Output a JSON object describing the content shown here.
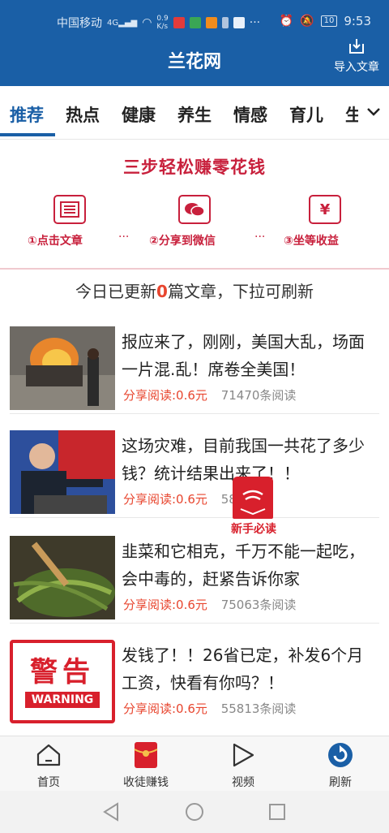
{
  "status_bar": {
    "carrier": "中国移动",
    "network": "4G",
    "speed_value": "0.9",
    "speed_unit": "K/s",
    "battery": "10",
    "time": "9:53"
  },
  "header": {
    "title": "兰花网",
    "import_label": "导入文章"
  },
  "tabs": [
    {
      "label": "推荐",
      "active": true
    },
    {
      "label": "热点"
    },
    {
      "label": "健康"
    },
    {
      "label": "养生"
    },
    {
      "label": "情感"
    },
    {
      "label": "育儿"
    },
    {
      "label": "生"
    }
  ],
  "promo": {
    "title": "三步轻松赚零花钱",
    "steps": [
      {
        "label": "①点击文章",
        "icon": "article-icon"
      },
      {
        "label": "②分享到微信",
        "icon": "wechat-icon"
      },
      {
        "label": "③坐等收益",
        "icon": "yuan-icon"
      }
    ],
    "separator": "···"
  },
  "refresh_tip": {
    "prefix": "今日已更新",
    "count": "0",
    "suffix": "篇文章，下拉可刷新"
  },
  "news": [
    {
      "title": "报应来了，刚刚，美国大乱，场面一片混.乱！席卷全美国！",
      "earn": "分享阅读:0.6元",
      "reads": "71470条阅读"
    },
    {
      "title": "这场灾难，目前我国一共花了多少钱？统计结果出来了！！",
      "earn": "分享阅读:0.6元",
      "reads": "58条阅读"
    },
    {
      "title": "韭菜和它相克，千万不能一起吃，会中毒的，赶紧告诉你家",
      "earn": "分享阅读:0.6元",
      "reads": "75063条阅读"
    },
    {
      "title": "发钱了！！26省已定，补发6个月工资，快看有你吗？！",
      "earn": "分享阅读:0.6元",
      "reads": "55813条阅读"
    }
  ],
  "warning_thumb": {
    "top": "警告",
    "bottom": "WARNING"
  },
  "float_badge": {
    "label": "新手必读"
  },
  "tabbar": [
    {
      "label": "首页",
      "icon": "home-icon"
    },
    {
      "label": "收徒赚钱",
      "icon": "red-envelope-icon"
    },
    {
      "label": "视频",
      "icon": "play-icon"
    },
    {
      "label": "刷新",
      "icon": "refresh-icon"
    }
  ],
  "colors": {
    "brand": "#1a5fa6",
    "accent_red": "#c8203c",
    "earn_red": "#e8462f"
  }
}
